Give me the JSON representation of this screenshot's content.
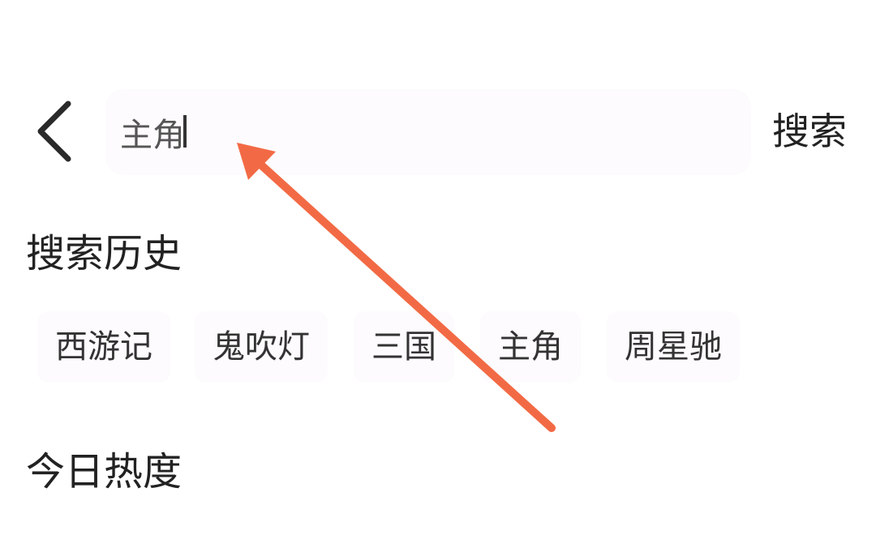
{
  "header": {
    "back_icon": "chevron-left-icon",
    "search": {
      "value": "主角",
      "placeholder": ""
    },
    "search_button_label": "搜索"
  },
  "history": {
    "title": "搜索历史",
    "items": [
      {
        "label": "西游记"
      },
      {
        "label": "鬼吹灯"
      },
      {
        "label": "三国"
      },
      {
        "label": "主角"
      },
      {
        "label": "周星驰"
      }
    ]
  },
  "hot": {
    "title": "今日热度"
  },
  "colors": {
    "annotation_arrow": "#f26a45",
    "chip_background": "#fdfbfd",
    "text_primary": "#222222"
  }
}
